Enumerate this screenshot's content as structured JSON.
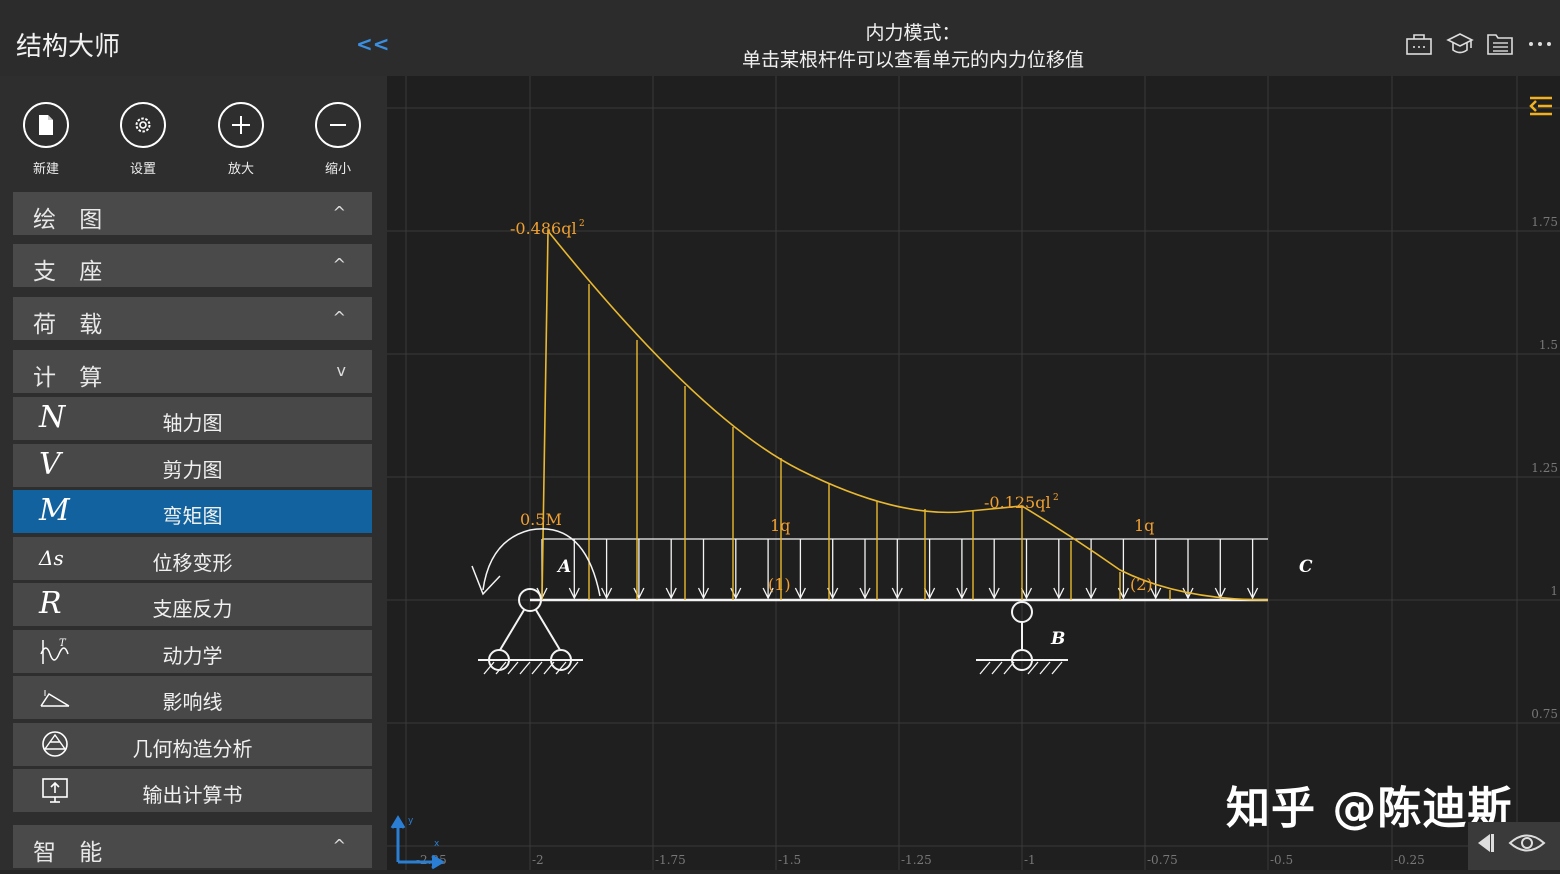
{
  "app": {
    "title": "结构大师",
    "collapse": "<<",
    "mode_line1": "内力模式：",
    "mode_line2": "单击某根杆件可以查看单元的内力位移值"
  },
  "top_icons": [
    "toolbox-icon",
    "graduation-cap-icon",
    "list-folder-icon",
    "more-icon"
  ],
  "toolbar": [
    {
      "label": "新建",
      "icon": "new-file-icon"
    },
    {
      "label": "设置",
      "icon": "gear-icon"
    },
    {
      "label": "放大",
      "icon": "zoom-in-icon"
    },
    {
      "label": "缩小",
      "icon": "zoom-out-icon"
    }
  ],
  "sections": [
    {
      "label": "绘 图",
      "chevron": "^"
    },
    {
      "label": "支 座",
      "chevron": "^"
    },
    {
      "label": "荷 载",
      "chevron": "^"
    },
    {
      "label": "计 算",
      "chevron": "v"
    }
  ],
  "calc_items": [
    {
      "glyph": "N",
      "label": "轴力图"
    },
    {
      "glyph": "V",
      "label": "剪力图"
    },
    {
      "glyph": "M",
      "label": "弯矩图",
      "active": true
    },
    {
      "glyph": "Δs",
      "label": "位移变形"
    },
    {
      "glyph": "R",
      "label": "支座反力"
    },
    {
      "glyph": "",
      "label": "动力学"
    },
    {
      "glyph": "",
      "label": "影响线"
    },
    {
      "glyph": "",
      "label": "几何构造分析"
    },
    {
      "glyph": "",
      "label": "输出计算书"
    }
  ],
  "smart_section": {
    "label": "智 能",
    "chevron": "^"
  },
  "canvas": {
    "x_ticks": [
      "-2.25",
      "-2",
      "-1.75",
      "-1.5",
      "-1.25",
      "-1",
      "-0.75",
      "-0.5",
      "-0.25"
    ],
    "y_ticks": [
      "1.75",
      "1.5",
      "1.25",
      "1",
      "0.75"
    ],
    "moment_labels": {
      "max": "-0.486ql",
      "b": "-0.125ql",
      "sup": "2"
    },
    "moment_applied": "0.5M",
    "load_labels": [
      "1q",
      "1q"
    ],
    "element_labels": [
      "(1)",
      "(2)"
    ],
    "node_labels": [
      "A",
      "B",
      "C"
    ],
    "axis_x": "x",
    "axis_y": "y"
  },
  "colors": {
    "accent": "#11629f",
    "moment": "#e8b830",
    "label": "#f0a030",
    "blue": "#3a8fe0"
  },
  "watermark": "知乎 @陈迪斯"
}
